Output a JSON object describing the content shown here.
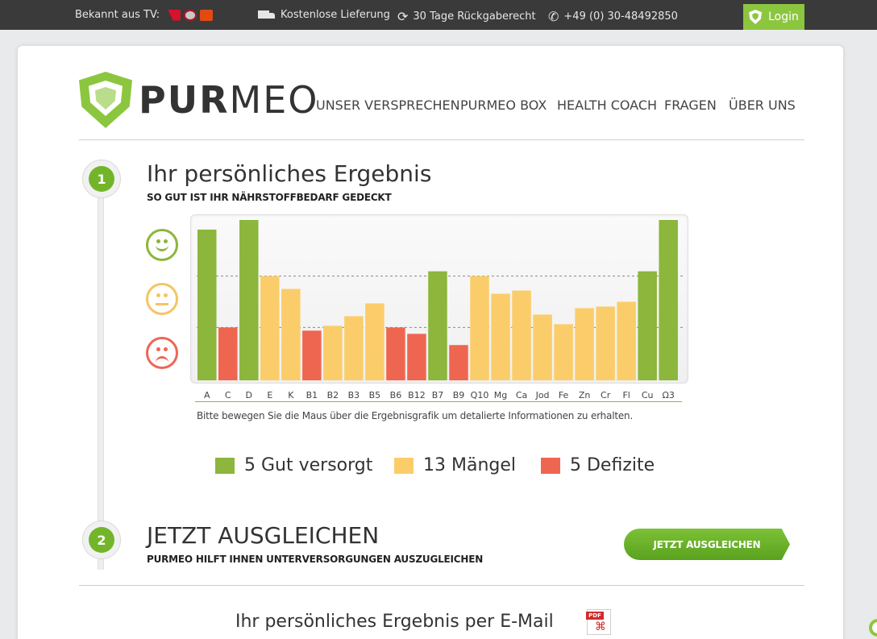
{
  "topbar": {
    "tv_label": "Bekannt aus TV:",
    "tv_logos": [
      "prosieben-logo",
      "sat1-logo",
      "kabel1-logo"
    ],
    "delivery": "Kostenlose Lieferung",
    "return": "30 Tage Rückgaberecht",
    "phone": "+49 (0) 30-48492850",
    "login": "Login"
  },
  "brand": {
    "bold": "PUR",
    "light": "MEO"
  },
  "nav": [
    "UNSER VERSPRECHEN",
    "PURMEO BOX",
    "HEALTH COACH",
    "FRAGEN",
    "ÜBER UNS"
  ],
  "step1": {
    "number": "1",
    "title": "Ihr persönliches Ergebnis",
    "subtitle": "SO GUT IST IHR NÄHRSTOFFBEDARF GEDECKT",
    "hint": "Bitte bewegen Sie die Maus über die Ergebnisgrafik um detalierte Informationen zu erhalten."
  },
  "chart_data": {
    "type": "bar",
    "categories": [
      "A",
      "C",
      "D",
      "E",
      "K",
      "B1",
      "B2",
      "B3",
      "B5",
      "B6",
      "B12",
      "B7",
      "B9",
      "Q10",
      "Mg",
      "Ca",
      "Jod",
      "Fe",
      "Zn",
      "Cr",
      "Fl",
      "Cu",
      "Ω3"
    ],
    "values": [
      94,
      33,
      100,
      65,
      57,
      31,
      34,
      40,
      48,
      33,
      29,
      68,
      22,
      65,
      54,
      56,
      41,
      35,
      45,
      46,
      49,
      68,
      100
    ],
    "status": [
      "good",
      "deficit",
      "good",
      "lack",
      "lack",
      "deficit",
      "lack",
      "lack",
      "lack",
      "deficit",
      "deficit",
      "good",
      "deficit",
      "lack",
      "lack",
      "lack",
      "lack",
      "lack",
      "lack",
      "lack",
      "lack",
      "good",
      "good"
    ],
    "colors": {
      "good": "#8cb63c",
      "lack": "#fbcd6a",
      "deficit": "#ef6650"
    },
    "ylim": [
      0,
      100
    ],
    "thresholds": [
      33,
      65
    ]
  },
  "legend": [
    {
      "label": "5 Gut versorgt",
      "color": "#8cb63c"
    },
    {
      "label": "13 Mängel",
      "color": "#fbcd6a"
    },
    {
      "label": "5 Defizite",
      "color": "#ef6650"
    }
  ],
  "step2": {
    "number": "2",
    "title": "JETZT AUSGLEICHEN",
    "subtitle": "PURMEO HILFT IHNEN UNTERVERSORGUNGEN AUSZUGLEICHEN",
    "button": "JETZT AUSGLEICHEN"
  },
  "email": {
    "title": "Ihr persönliches Ergebnis per E-Mail",
    "pdf_tag": "PDF"
  }
}
